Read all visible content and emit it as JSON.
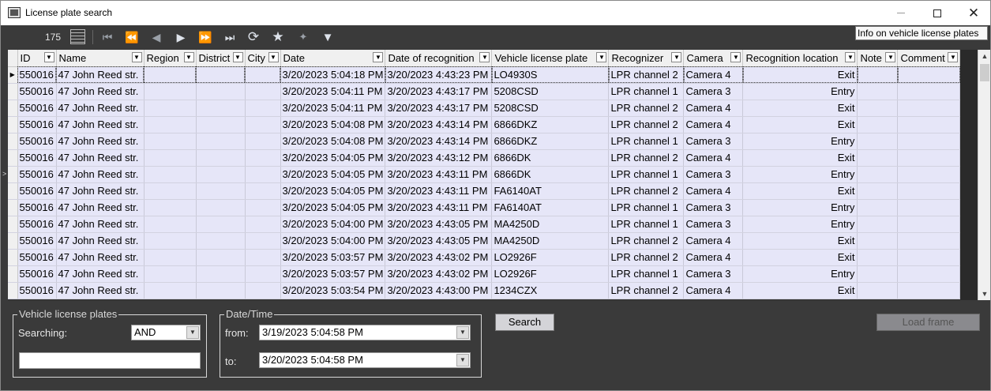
{
  "window": {
    "title": "License plate search"
  },
  "toolbar": {
    "record_count": "175",
    "tooltip": "Info on vehicle license plates",
    "icons": [
      "grid-view-icon",
      "first-page-icon",
      "previous-page-icon",
      "previous-icon",
      "next-icon",
      "next-page-icon",
      "last-page-icon",
      "refresh-icon",
      "favorite-icon",
      "add-favorite-icon",
      "filter-icon"
    ]
  },
  "table": {
    "columns": [
      "ID",
      "Name",
      "Region",
      "District",
      "City",
      "Date",
      "Date of recognition",
      "Vehicle license plate",
      "Recognizer",
      "Camera",
      "Recognition location",
      "Note",
      "Comment"
    ],
    "rows": [
      [
        "550016",
        "47 John Reed str.",
        "",
        "",
        "",
        "3/20/2023 5:04:18 PM",
        "3/20/2023 4:43:23 PM",
        "LO4930S",
        "LPR channel  2",
        "Camera 4",
        "Exit",
        "",
        ""
      ],
      [
        "550016",
        "47 John Reed str.",
        "",
        "",
        "",
        "3/20/2023 5:04:11 PM",
        "3/20/2023 4:43:17 PM",
        "5208CSD",
        "LPR channel  1",
        "Camera 3",
        "Entry",
        "",
        ""
      ],
      [
        "550016",
        "47 John Reed str.",
        "",
        "",
        "",
        "3/20/2023 5:04:11 PM",
        "3/20/2023 4:43:17 PM",
        "5208CSD",
        "LPR channel  2",
        "Camera 4",
        "Exit",
        "",
        ""
      ],
      [
        "550016",
        "47 John Reed str.",
        "",
        "",
        "",
        "3/20/2023 5:04:08 PM",
        "3/20/2023 4:43:14 PM",
        "6866DKZ",
        "LPR channel  2",
        "Camera 4",
        "Exit",
        "",
        ""
      ],
      [
        "550016",
        "47 John Reed str.",
        "",
        "",
        "",
        "3/20/2023 5:04:08 PM",
        "3/20/2023 4:43:14 PM",
        "6866DKZ",
        "LPR channel  1",
        "Camera 3",
        "Entry",
        "",
        ""
      ],
      [
        "550016",
        "47 John Reed str.",
        "",
        "",
        "",
        "3/20/2023 5:04:05 PM",
        "3/20/2023 4:43:12 PM",
        "6866DK",
        "LPR channel  2",
        "Camera 4",
        "Exit",
        "",
        ""
      ],
      [
        "550016",
        "47 John Reed str.",
        "",
        "",
        "",
        "3/20/2023 5:04:05 PM",
        "3/20/2023 4:43:11 PM",
        "6866DK",
        "LPR channel  1",
        "Camera 3",
        "Entry",
        "",
        ""
      ],
      [
        "550016",
        "47 John Reed str.",
        "",
        "",
        "",
        "3/20/2023 5:04:05 PM",
        "3/20/2023 4:43:11 PM",
        "FA6140AT",
        "LPR channel  2",
        "Camera 4",
        "Exit",
        "",
        ""
      ],
      [
        "550016",
        "47 John Reed str.",
        "",
        "",
        "",
        "3/20/2023 5:04:05 PM",
        "3/20/2023 4:43:11 PM",
        "FA6140AT",
        "LPR channel  1",
        "Camera 3",
        "Entry",
        "",
        ""
      ],
      [
        "550016",
        "47 John Reed str.",
        "",
        "",
        "",
        "3/20/2023 5:04:00 PM",
        "3/20/2023 4:43:05 PM",
        "MA4250D",
        "LPR channel  1",
        "Camera 3",
        "Entry",
        "",
        ""
      ],
      [
        "550016",
        "47 John Reed str.",
        "",
        "",
        "",
        "3/20/2023 5:04:00 PM",
        "3/20/2023 4:43:05 PM",
        "MA4250D",
        "LPR channel  2",
        "Camera 4",
        "Exit",
        "",
        ""
      ],
      [
        "550016",
        "47 John Reed str.",
        "",
        "",
        "",
        "3/20/2023 5:03:57 PM",
        "3/20/2023 4:43:02 PM",
        "LO2926F",
        "LPR channel  2",
        "Camera 4",
        "Exit",
        "",
        ""
      ],
      [
        "550016",
        "47 John Reed str.",
        "",
        "",
        "",
        "3/20/2023 5:03:57 PM",
        "3/20/2023 4:43:02 PM",
        "LO2926F",
        "LPR channel  1",
        "Camera 3",
        "Entry",
        "",
        ""
      ],
      [
        "550016",
        "47 John Reed str.",
        "",
        "",
        "",
        "3/20/2023 5:03:54 PM",
        "3/20/2023 4:43:00 PM",
        "1234CZX",
        "LPR channel  2",
        "Camera 4",
        "Exit",
        "",
        ""
      ]
    ]
  },
  "plates_panel": {
    "legend": "Vehicle license plates",
    "searching_label": "Searching:",
    "operator_value": "AND",
    "plate_input_value": ""
  },
  "datetime_panel": {
    "legend": "Date/Time",
    "from_label": "from:",
    "from_value": "3/19/2023 5:04:58 PM",
    "to_label": "to:",
    "to_value": "3/20/2023 5:04:58 PM"
  },
  "buttons": {
    "search": "Search",
    "load_frame": "Load frame"
  },
  "colors": {
    "row_background": "#e6e6f8",
    "panel_background": "#3a3a3a"
  }
}
